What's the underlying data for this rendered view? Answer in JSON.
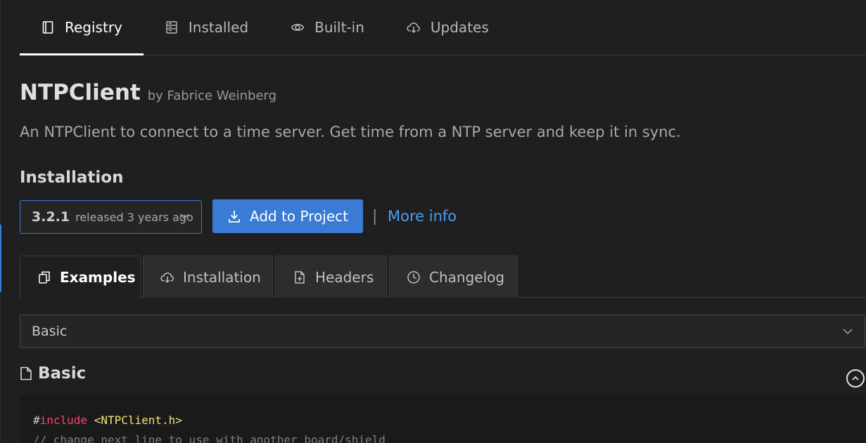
{
  "top_tabs": [
    {
      "label": "Registry",
      "icon": "book-icon",
      "active": true
    },
    {
      "label": "Installed",
      "icon": "server-icon",
      "active": false
    },
    {
      "label": "Built-in",
      "icon": "eye-icon",
      "active": false
    },
    {
      "label": "Updates",
      "icon": "cloud-download-icon",
      "active": false
    }
  ],
  "package": {
    "name": "NTPClient",
    "author": "by Fabrice Weinberg",
    "description": "An NTPClient to connect to a time server. Get time from a NTP server and keep it in sync."
  },
  "installation": {
    "heading": "Installation",
    "version": "3.2.1",
    "released": "released 3 years ago",
    "add_label": "Add to Project",
    "separator": "|",
    "more_info": "More info"
  },
  "sub_tabs": [
    {
      "label": "Examples",
      "icon": "copy-icon",
      "active": true
    },
    {
      "label": "Installation",
      "icon": "cloud-download-icon",
      "active": false
    },
    {
      "label": "Headers",
      "icon": "file-plus-icon",
      "active": false
    },
    {
      "label": "Changelog",
      "icon": "clock-icon",
      "active": false
    }
  ],
  "example_select": {
    "value": "Basic"
  },
  "example": {
    "heading": "Basic",
    "code": {
      "line1_hash": "#",
      "line1_directive": "include",
      "line1_header": "<NTPClient.h>",
      "line2_comment": "// change next line to use with another board/shield"
    }
  },
  "colors": {
    "accent": "#3a7bd5",
    "link": "#4c9cf0",
    "background": "#1f1f1f"
  }
}
